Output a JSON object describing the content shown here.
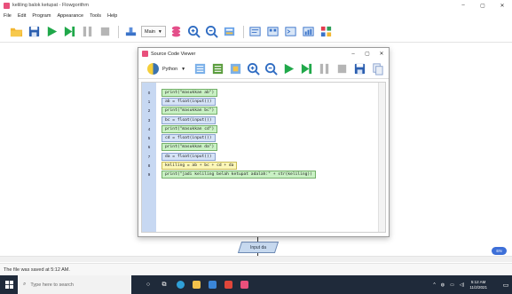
{
  "window": {
    "title": "keliling balok ketupat - Flowgorithm"
  },
  "menu": [
    "File",
    "Edit",
    "Program",
    "Appearance",
    "Tools",
    "Help"
  ],
  "toolbar": {
    "function_select": "Main"
  },
  "dialog": {
    "title": "Source Code Viewer",
    "language": "Python",
    "line_numbers": [
      "0",
      "1",
      "2",
      "3",
      "4",
      "5",
      "6",
      "7",
      "8",
      "9"
    ],
    "lines": [
      {
        "text": "print(\"masukkan ab\")",
        "kind": "out"
      },
      {
        "text": "ab = float(input())",
        "kind": "inp"
      },
      {
        "text": "print(\"masukkan bc\")",
        "kind": "out"
      },
      {
        "text": "bc = float(input())",
        "kind": "inp"
      },
      {
        "text": "print(\"masukkan cd\")",
        "kind": "out"
      },
      {
        "text": "cd = float(input())",
        "kind": "inp"
      },
      {
        "text": "print(\"masukkan da\")",
        "kind": "out"
      },
      {
        "text": "da = float(input())",
        "kind": "inp"
      },
      {
        "text": "keliling = ab + bc + cd + da",
        "kind": "asg"
      },
      {
        "text": "print(\"jadi keliling belah ketupat adalah:\" + str(keliling))",
        "kind": "out"
      }
    ]
  },
  "flowchart": {
    "shape_label": "Input da"
  },
  "status": {
    "message": "The file was saved at 5:12 AM."
  },
  "lang_badge": "EN",
  "taskbar": {
    "search_placeholder": "Type here to search",
    "time": "5:12 AM",
    "date": "11/2/2021"
  },
  "colors": {
    "output": "#c9f1c4",
    "input": "#d6e3f7",
    "assign": "#fcf7b8",
    "gutter": "#c7d8f2"
  }
}
